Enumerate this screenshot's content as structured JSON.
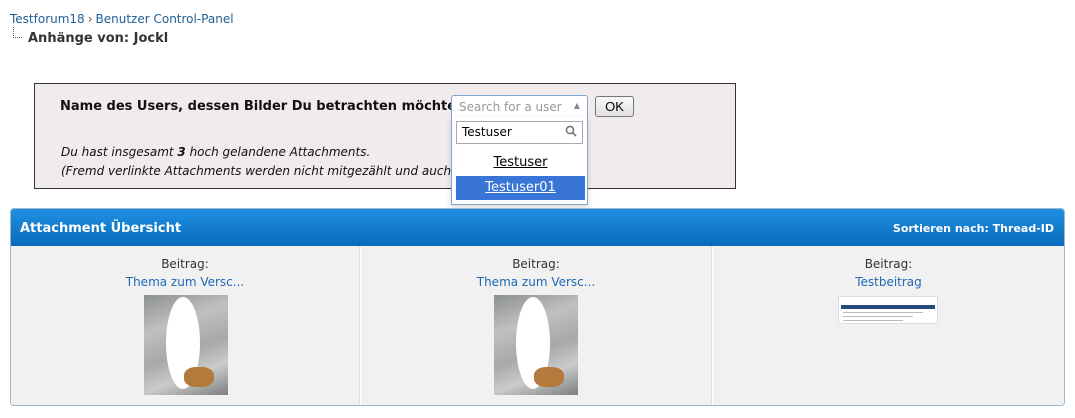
{
  "breadcrumb": {
    "forum": "Testforum18",
    "separator": "›",
    "section": "Benutzer Control-Panel",
    "current": "Anhänge von: Jockl"
  },
  "form": {
    "question": "Name des Users, dessen Bilder Du betrachten möchtest:",
    "info_prefix": "Du hast insgesamt ",
    "info_count": "3",
    "info_suffix": " hoch gelandene Attachments.",
    "info_line2": "(Fremd verlinkte Attachments werden nicht mitgezählt und auch nich",
    "select_placeholder": "Search for a user",
    "search_value": "Testuser",
    "options": [
      "Testuser",
      "Testuser01"
    ],
    "highlighted_option": "Testuser01",
    "ok_label": "OK"
  },
  "overview": {
    "title": "Attachment Übersicht",
    "sort_label": "Sortieren nach: Thread-ID",
    "header_color": "#0a6bbd",
    "items": [
      {
        "label": "Beitrag:",
        "title": "Thema zum Versc..."
      },
      {
        "label": "Beitrag:",
        "title": "Thema zum Versc..."
      },
      {
        "label": "Beitrag:",
        "title": "Testbeitrag"
      }
    ]
  }
}
